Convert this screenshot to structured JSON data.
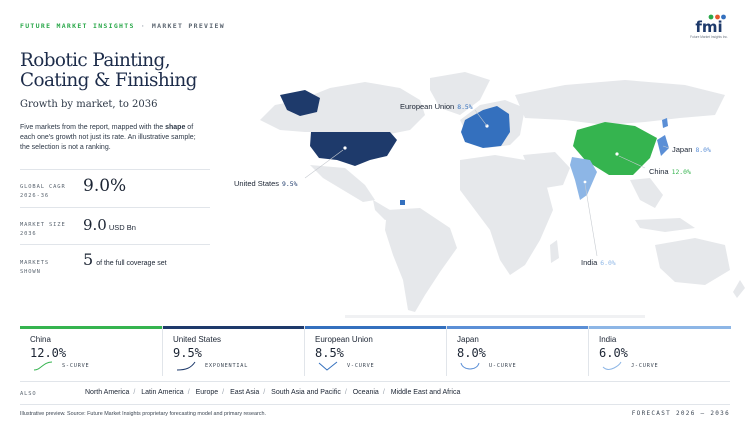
{
  "header": {
    "brand": "FUTURE MARKET INSIGHTS",
    "separator": "·",
    "kind": "MARKET PREVIEW",
    "logo_text": "fmi",
    "logo_tagline": "Future Market Insights Inc."
  },
  "title": "Robotic Painting, Coating & Finishing",
  "subtitle": "Growth by market, to 2036",
  "intro": {
    "before": "Five markets from the report, mapped with the ",
    "bold": "shape",
    "after": " of each one's growth not just its rate. An illustrative sample; the selection is not a ranking."
  },
  "stats": [
    {
      "label": "GLOBAL CAGR",
      "sublabel": "2026-36",
      "value": "9.0%",
      "unit": ""
    },
    {
      "label": "MARKET SIZE",
      "sublabel": "2036",
      "value": "9.0",
      "unit": "USD Bn"
    },
    {
      "label": "MARKETS",
      "sublabel": "SHOWN",
      "value": "5",
      "unit": "of the full coverage set"
    }
  ],
  "map_labels": {
    "european_union": {
      "name": "European Union",
      "pct": "8.5%"
    },
    "united_states": {
      "name": "United States",
      "pct": "9.5%"
    },
    "japan": {
      "name": "Japan",
      "pct": "8.0%"
    },
    "china": {
      "name": "China",
      "pct": "12.0%"
    },
    "india": {
      "name": "India",
      "pct": "6.0%"
    }
  },
  "colors": {
    "china": "#35b44f",
    "united_states": "#1e3a6b",
    "european_union": "#3470be",
    "japan": "#5b8fd6",
    "india": "#8db6e6",
    "land": "#e6e8eb"
  },
  "markets": [
    {
      "name": "China",
      "pct": "12.0%",
      "shape": "S-CURVE",
      "color": "#35b44f",
      "curve": "s"
    },
    {
      "name": "United States",
      "pct": "9.5%",
      "shape": "EXPONENTIAL",
      "color": "#1e3a6b",
      "curve": "exp"
    },
    {
      "name": "European Union",
      "pct": "8.5%",
      "shape": "V-CURVE",
      "color": "#3470be",
      "curve": "v"
    },
    {
      "name": "Japan",
      "pct": "8.0%",
      "shape": "U-CURVE",
      "color": "#5b8fd6",
      "curve": "u"
    },
    {
      "name": "India",
      "pct": "6.0%",
      "shape": "J-CURVE",
      "color": "#8db6e6",
      "curve": "j"
    }
  ],
  "also": {
    "label": "ALSO",
    "items": [
      "North America",
      "Latin America",
      "Europe",
      "East Asia",
      "South Asia and Pacific",
      "Oceania",
      "Middle East and Africa"
    ]
  },
  "footer": {
    "source": "Illustrative preview. Source: Future Market Insights proprietary forecasting model and primary research.",
    "forecast": "FORECAST 2026 – 2036"
  }
}
